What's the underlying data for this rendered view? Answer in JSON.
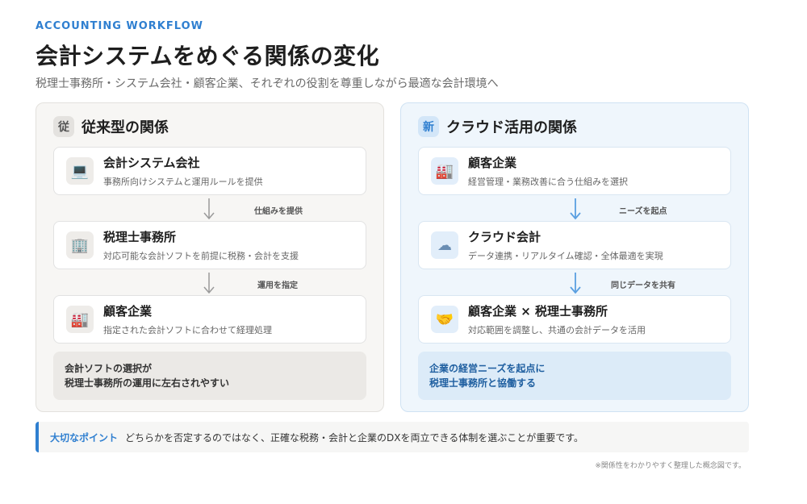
{
  "header": {
    "eyebrow": "ACCOUNTING WORKFLOW",
    "title": "会計システムをめぐる関係の変化",
    "subtitle": "税理士事務所・システム会社・顧客企業、それぞれの役割を尊重しながら最適な会計環境へ"
  },
  "left": {
    "badge": "従",
    "title": "従来型の関係",
    "cards": [
      {
        "icon": "computer-icon",
        "glyph": "💻",
        "title": "会計システム会社",
        "desc": "事務所向けシステムと運用ルールを提供"
      },
      {
        "icon": "office-building-icon",
        "glyph": "🏢",
        "title": "税理士事務所",
        "desc": "対応可能な会計ソフトを前提に税務・会計を支援"
      },
      {
        "icon": "factory-icon",
        "glyph": "🏭",
        "title": "顧客企業",
        "desc": "指定された会計ソフトに合わせて経理処理"
      }
    ],
    "arrows": [
      "仕組みを提供",
      "運用を指定"
    ],
    "note_line1": "会計ソフトの選択が",
    "note_line2": "税理士事務所の運用に左右されやすい",
    "arrow_color": "#9a9a9a"
  },
  "right": {
    "badge": "新",
    "title": "クラウド活用の関係",
    "cards": [
      {
        "icon": "factory-icon",
        "glyph": "🏭",
        "title": "顧客企業",
        "desc": "経営管理・業務改善に合う仕組みを選択"
      },
      {
        "icon": "cloud-icon",
        "glyph": "☁",
        "title": "クラウド会計",
        "desc": "データ連携・リアルタイム確認・全体最適を実現"
      },
      {
        "icon": "handshake-icon",
        "glyph": "🤝",
        "title": "顧客企業 × 税理士事務所",
        "desc": "対応範囲を調整し、共通の会計データを活用"
      }
    ],
    "arrows": [
      "ニーズを起点",
      "同じデータを共有"
    ],
    "note_line1": "企業の経営ニーズを起点に",
    "note_line2": "税理士事務所と協働する",
    "arrow_color": "#5a9fe0"
  },
  "point": {
    "label": "大切なポイント",
    "text": "どちらかを否定するのではなく、正確な税務・会計と企業のDXを両立できる体制を選ぶことが重要です。"
  },
  "footnote": "※関係性をわかりやすく整理した概念図です。",
  "colors": {
    "accent": "#2f7fd0"
  }
}
